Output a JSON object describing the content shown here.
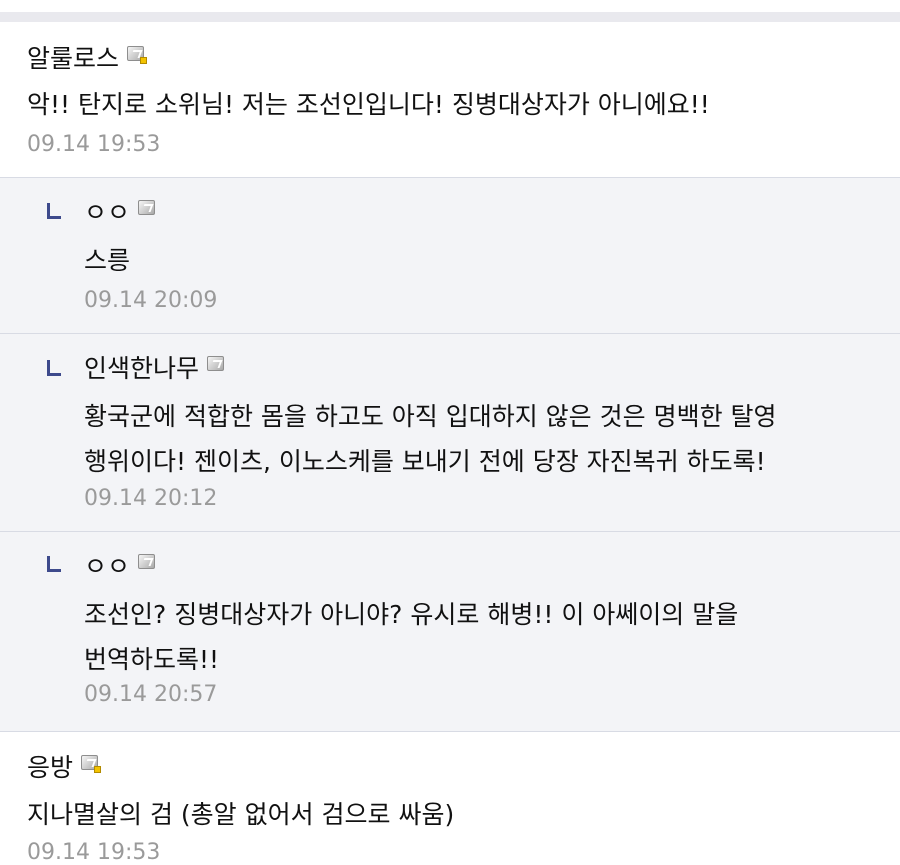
{
  "comments": [
    {
      "author": "알룰로스",
      "text": "악!! 탄지로 소위님! 저는 조선인입니다! 징병대상자가 아니에요!!",
      "time": "09.14 19:53"
    },
    {
      "author": "ㅇㅇ",
      "text": "스릉",
      "time": "09.14 20:09"
    },
    {
      "author": "인색한나무",
      "text": "황국군에 적합한 몸을 하고도 아직 입대하지 않은 것은 명백한 탈영 행위이다! 젠이츠, 이노스케를 보내기 전에 당장 자진복귀 하도록!",
      "time": "09.14 20:12"
    },
    {
      "author": "ㅇㅇ",
      "text": "조선인? 징병대상자가 아니야? 유시로 해병!! 이 아쎄이의 말을 번역하도록!!",
      "time": "09.14 20:57"
    },
    {
      "author": "응방",
      "text": "지나멸살의 검 (총알 없어서 검으로 싸움)",
      "time": "09.14 19:53"
    }
  ]
}
